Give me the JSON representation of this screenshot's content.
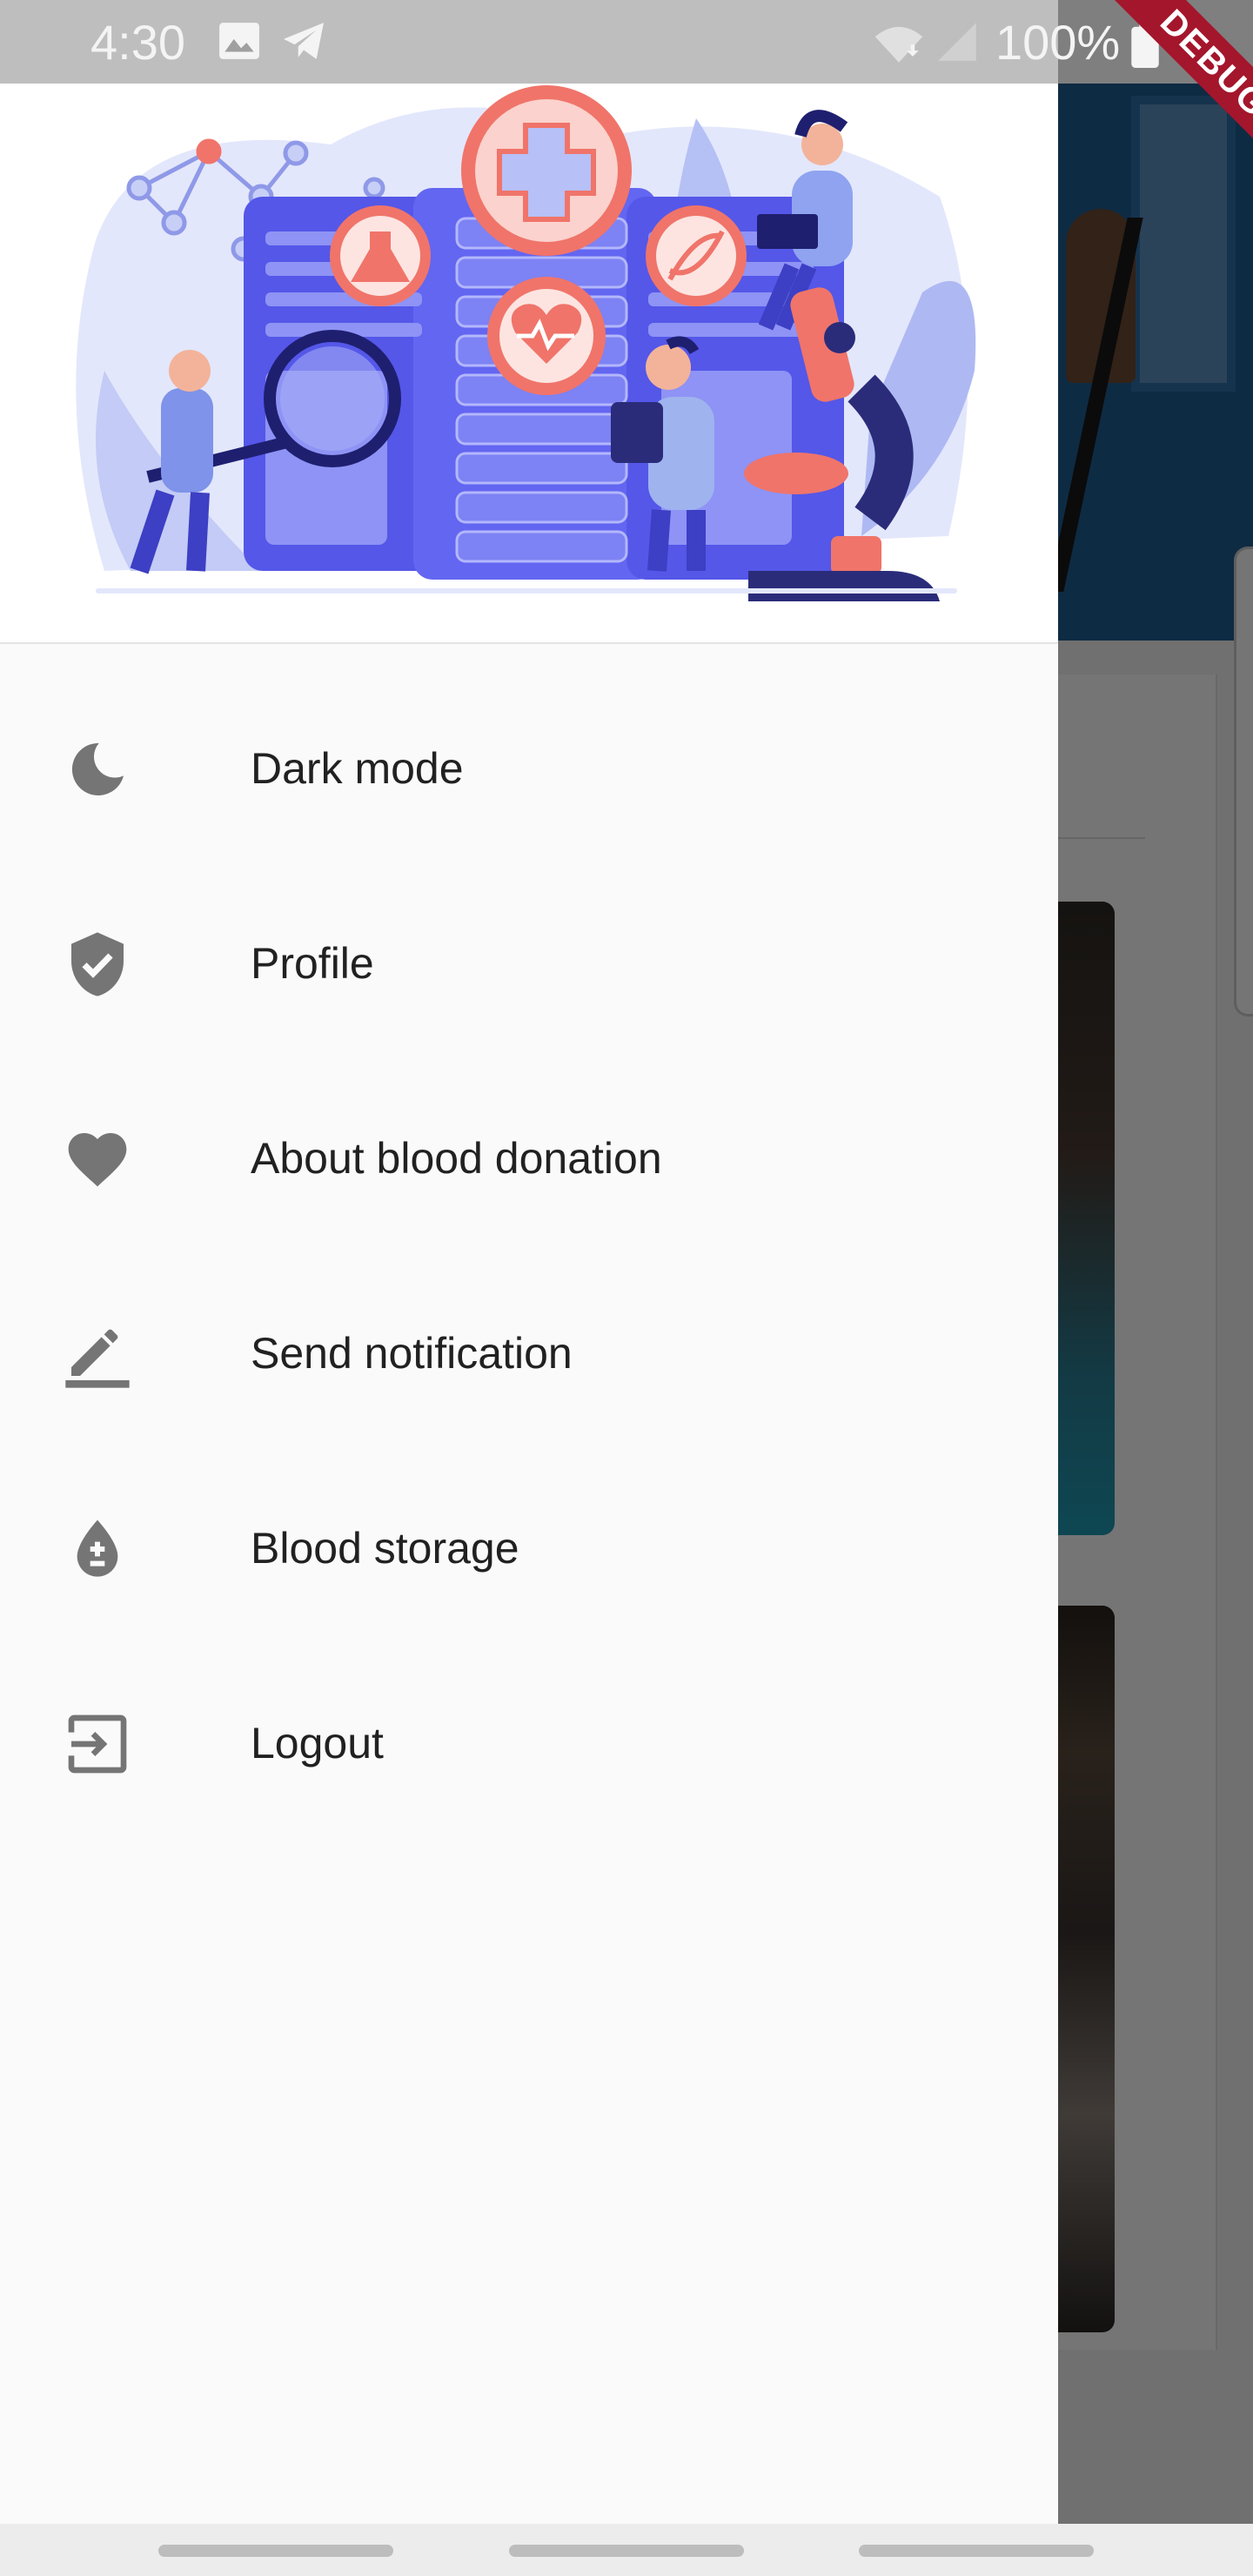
{
  "status_bar": {
    "time": "4:30",
    "battery": "100%",
    "icons": [
      "gallery-icon",
      "telegram-icon",
      "wifi-icon",
      "signal-icon",
      "battery-icon"
    ]
  },
  "debug_banner": "DEBUG",
  "drawer": {
    "header_image": "medical-research-illustration",
    "items": [
      {
        "label": "Dark mode",
        "icon": "moon-icon"
      },
      {
        "label": "Profile",
        "icon": "shield-check-icon"
      },
      {
        "label": "About blood donation",
        "icon": "heart-icon"
      },
      {
        "label": "Send notification",
        "icon": "edit-pencil-icon"
      },
      {
        "label": "Blood storage",
        "icon": "blood-drop-plus-minus-icon"
      },
      {
        "label": "Logout",
        "icon": "logout-icon"
      }
    ]
  },
  "colors": {
    "drawer_bg": "#fafafa",
    "icon_gray": "#757575",
    "text": "#212121",
    "illustration_blue": "#5b5ef0",
    "illustration_coral": "#f0746a",
    "debug_red": "#a4162c"
  }
}
